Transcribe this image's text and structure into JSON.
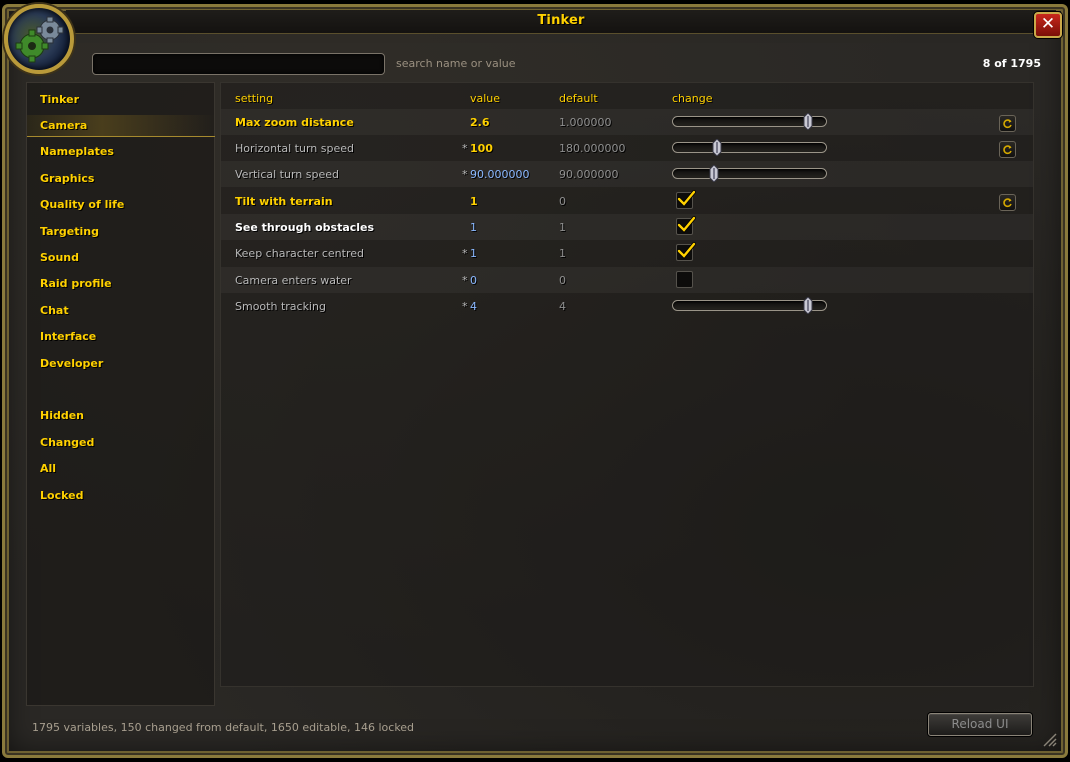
{
  "window": {
    "title": "Tinker",
    "close_symbol": "✕"
  },
  "search": {
    "value": "",
    "hint": "search name or value",
    "count": "8 of 1795"
  },
  "sidebar": {
    "items": [
      {
        "label": "Tinker",
        "selected": false
      },
      {
        "label": "Camera",
        "selected": true
      },
      {
        "label": "Nameplates",
        "selected": false
      },
      {
        "label": "Graphics",
        "selected": false
      },
      {
        "label": "Quality of life",
        "selected": false
      },
      {
        "label": "Targeting",
        "selected": false
      },
      {
        "label": "Sound",
        "selected": false
      },
      {
        "label": "Raid profile",
        "selected": false
      },
      {
        "label": "Chat",
        "selected": false
      },
      {
        "label": "Interface",
        "selected": false
      },
      {
        "label": "Developer",
        "selected": false
      }
    ],
    "filters": [
      {
        "label": "Hidden"
      },
      {
        "label": "Changed"
      },
      {
        "label": "All"
      },
      {
        "label": "Locked"
      }
    ]
  },
  "table": {
    "headers": {
      "setting": "setting",
      "value": "value",
      "default": "default",
      "change": "change"
    },
    "rows": [
      {
        "name": "Max zoom distance",
        "name_style": "yellow",
        "star": "",
        "value": "2.6",
        "value_style": "yellow",
        "default": "1.000000",
        "control": "slider",
        "slider_fraction": 0.88,
        "reset": true
      },
      {
        "name": "Horizontal turn speed",
        "name_style": "gray",
        "star": "*",
        "value": "100",
        "value_style": "yellow",
        "default": "180.000000",
        "control": "slider",
        "slider_fraction": 0.29,
        "reset": true
      },
      {
        "name": "Vertical turn speed",
        "name_style": "gray",
        "star": "*",
        "value": "90.000000",
        "value_style": "blue",
        "default": "90.000000",
        "control": "slider",
        "slider_fraction": 0.27,
        "reset": false
      },
      {
        "name": "Tilt with terrain",
        "name_style": "yellow",
        "star": "",
        "value": "1",
        "value_style": "yellow",
        "default": "0",
        "control": "checkbox",
        "checked": true,
        "reset": true
      },
      {
        "name": "See through obstacles",
        "name_style": "white",
        "star": "",
        "value": "1",
        "value_style": "blue",
        "default": "1",
        "control": "checkbox",
        "checked": true,
        "reset": false
      },
      {
        "name": "Keep character centred",
        "name_style": "gray",
        "star": "*",
        "value": "1",
        "value_style": "blue",
        "default": "1",
        "control": "checkbox",
        "checked": true,
        "reset": false
      },
      {
        "name": "Camera enters water",
        "name_style": "gray",
        "star": "*",
        "value": "0",
        "value_style": "blue",
        "default": "0",
        "control": "checkbox",
        "checked": false,
        "reset": false
      },
      {
        "name": "Smooth tracking",
        "name_style": "gray",
        "star": "*",
        "value": "4",
        "value_style": "blue",
        "default": "4",
        "control": "slider",
        "slider_fraction": 0.88,
        "reset": false
      }
    ]
  },
  "footer": {
    "status": "1795 variables, 150 changed from default, 1650 editable, 146 locked",
    "reload_label": "Reload UI"
  },
  "icons": {
    "portrait": "gears-icon",
    "reset": "reset-icon",
    "grip": "resize-grip-icon"
  },
  "colors": {
    "accent": "#ffd100",
    "value_blue": "#8ab8ff",
    "frame_gold": "#8a7a3c",
    "close_red": "#c8281c"
  }
}
